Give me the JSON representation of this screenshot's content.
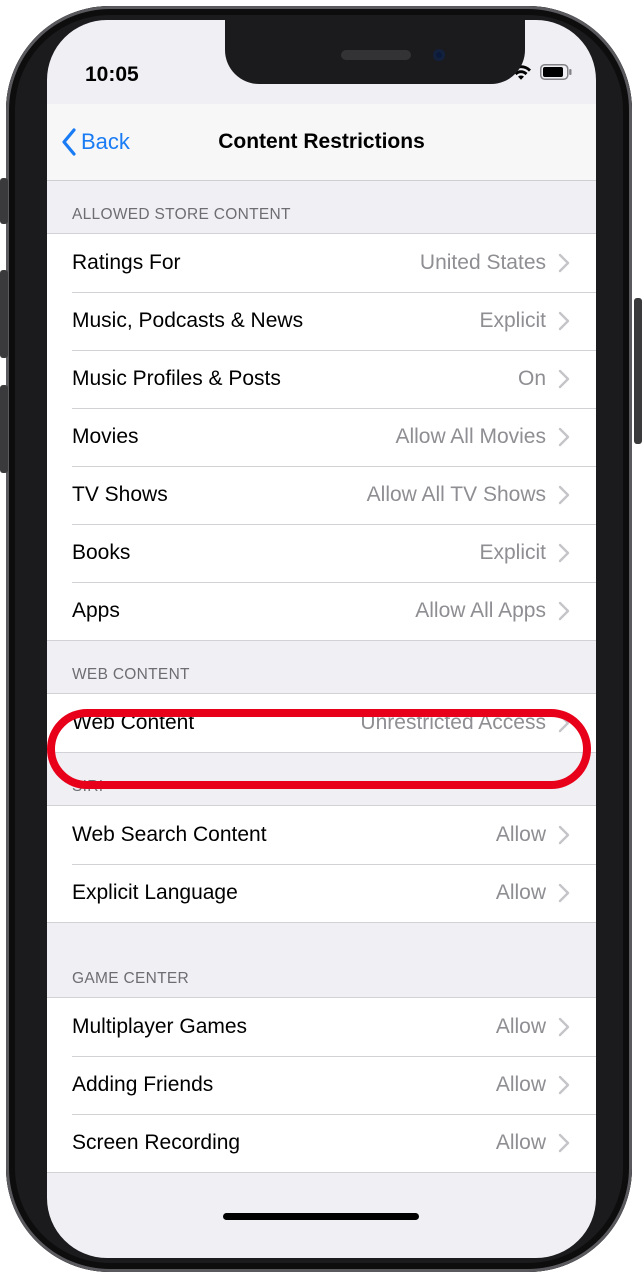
{
  "status": {
    "time": "10:05"
  },
  "nav": {
    "back_label": "Back",
    "title": "Content Restrictions"
  },
  "sections": {
    "allowed_store": {
      "header": "ALLOWED STORE CONTENT",
      "rows": [
        {
          "label": "Ratings For",
          "value": "United States"
        },
        {
          "label": "Music, Podcasts & News",
          "value": "Explicit"
        },
        {
          "label": "Music Profiles & Posts",
          "value": "On"
        },
        {
          "label": "Movies",
          "value": "Allow All Movies"
        },
        {
          "label": "TV Shows",
          "value": "Allow All TV Shows"
        },
        {
          "label": "Books",
          "value": "Explicit"
        },
        {
          "label": "Apps",
          "value": "Allow All Apps"
        }
      ]
    },
    "web": {
      "header": "WEB CONTENT",
      "rows": [
        {
          "label": "Web Content",
          "value": "Unrestricted Access"
        }
      ]
    },
    "siri": {
      "header": "SIRI",
      "rows": [
        {
          "label": "Web Search Content",
          "value": "Allow"
        },
        {
          "label": "Explicit Language",
          "value": "Allow"
        }
      ]
    },
    "game_center": {
      "header": "GAME CENTER",
      "rows": [
        {
          "label": "Multiplayer Games",
          "value": "Allow"
        },
        {
          "label": "Adding Friends",
          "value": "Allow"
        },
        {
          "label": "Screen Recording",
          "value": "Allow"
        }
      ]
    }
  },
  "colors": {
    "accent": "#1a7cf4",
    "highlight": "#e8001a",
    "background": "#efeff4"
  }
}
